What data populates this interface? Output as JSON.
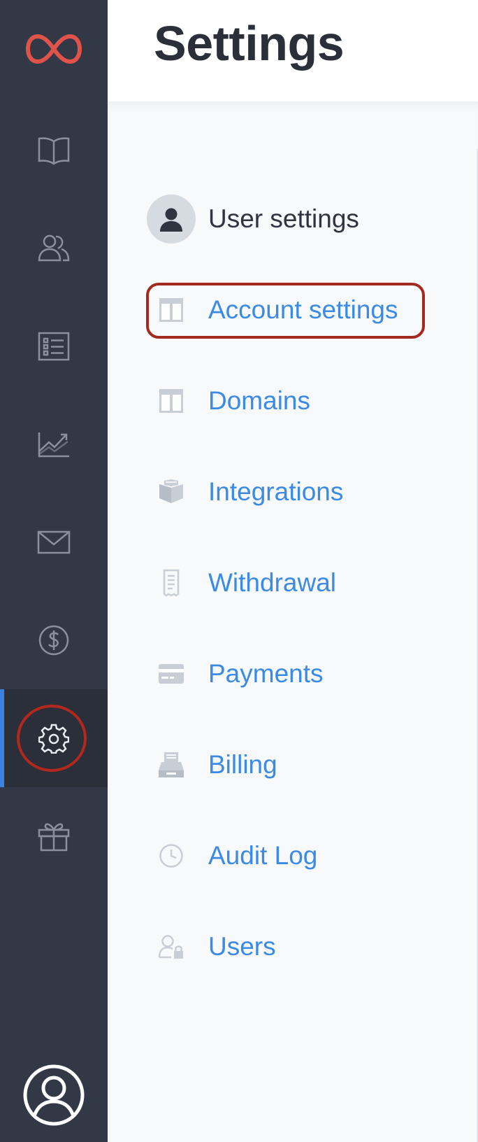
{
  "app": {
    "logo_icon": "infinity-logo-icon",
    "brand_color": "#e0534a"
  },
  "sidebar": {
    "items": [
      {
        "icon": "book-icon",
        "active": false
      },
      {
        "icon": "users-icon",
        "active": false
      },
      {
        "icon": "list-icon",
        "active": false
      },
      {
        "icon": "chart-icon",
        "active": false
      },
      {
        "icon": "mail-icon",
        "active": false
      },
      {
        "icon": "dollar-icon",
        "active": false
      },
      {
        "icon": "gear-icon",
        "active": true
      },
      {
        "icon": "gift-icon",
        "active": false
      }
    ],
    "active_indicator_color": "#3b82e0",
    "profile_icon": "user-profile-icon"
  },
  "header": {
    "title": "Settings"
  },
  "settings": {
    "items": [
      {
        "label": "User settings",
        "icon": "user-avatar-icon"
      },
      {
        "label": "Account settings",
        "icon": "account-panel-icon",
        "highlighted": true
      },
      {
        "label": "Domains",
        "icon": "domains-panel-icon"
      },
      {
        "label": "Integrations",
        "icon": "integrations-box-icon"
      },
      {
        "label": "Withdrawal",
        "icon": "receipt-icon"
      },
      {
        "label": "Payments",
        "icon": "credit-card-icon"
      },
      {
        "label": "Billing",
        "icon": "billing-tray-icon"
      },
      {
        "label": "Audit Log",
        "icon": "clock-icon"
      },
      {
        "label": "Users",
        "icon": "user-lock-icon"
      }
    ],
    "link_color": "#3a8ae6",
    "highlight_color": "#a4291f"
  }
}
